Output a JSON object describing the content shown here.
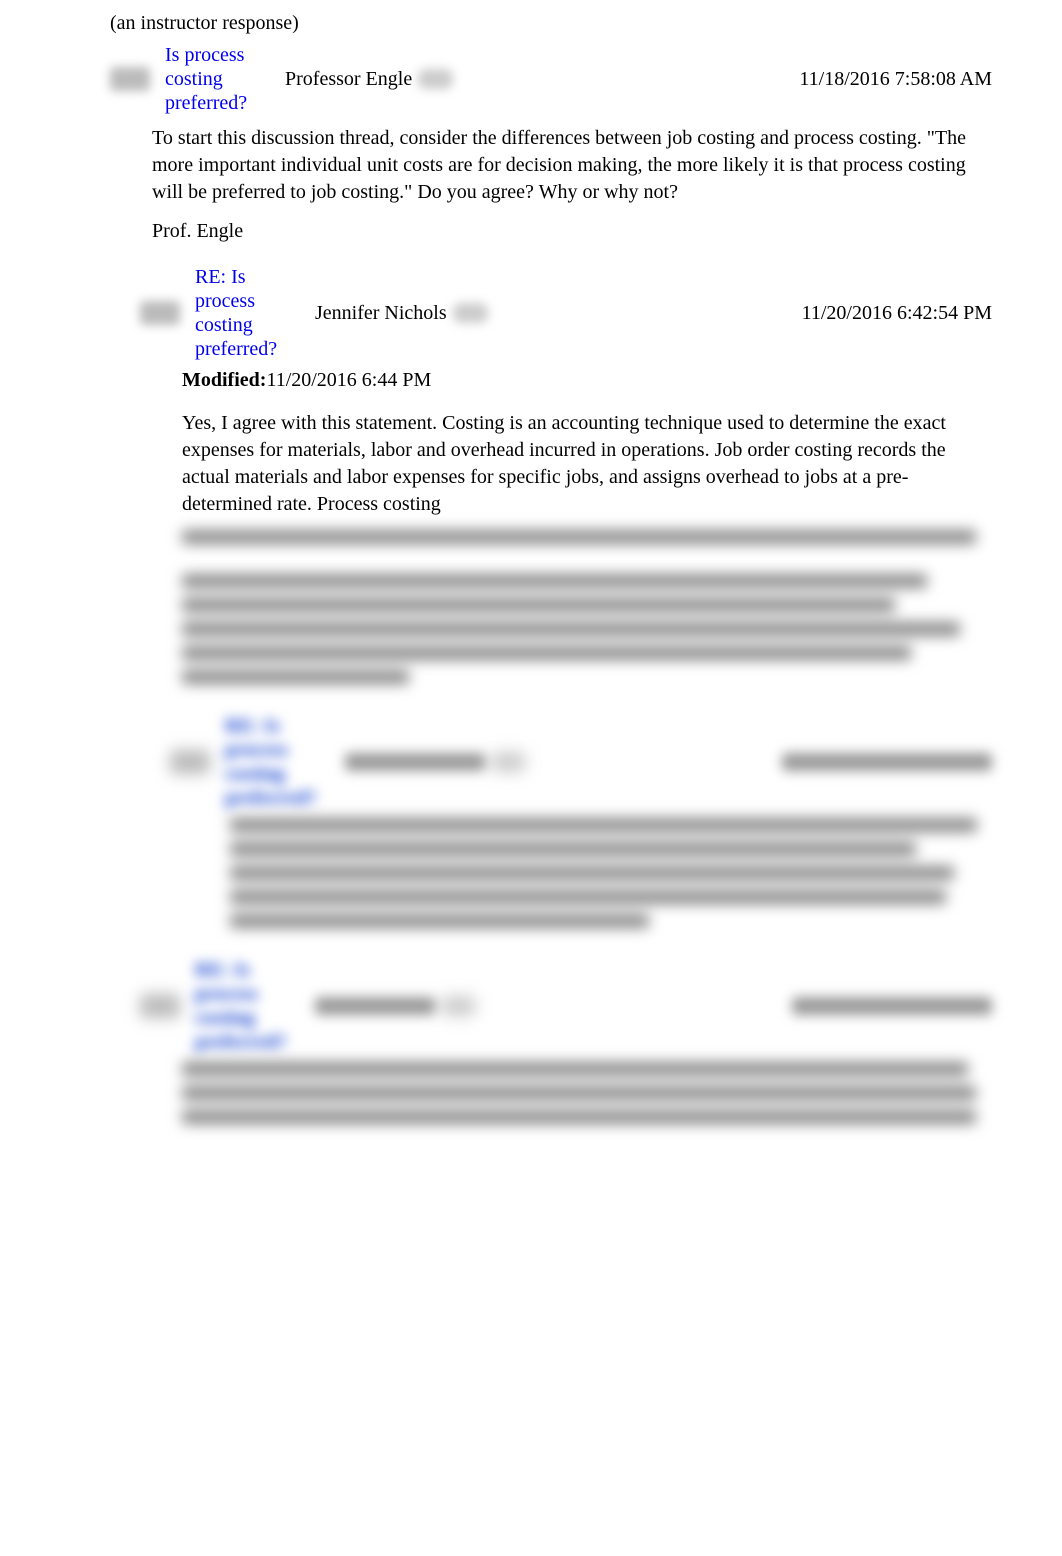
{
  "instructor_note": "(an instructor response)",
  "thread": {
    "subject": "Is process costing preferred?",
    "author": "Professor Engle",
    "timestamp": "11/18/2016 7:58:08 AM",
    "body_p1": "To start this discussion thread, consider the differences between job costing and process costing. \"The more important individual unit costs are for decision making, the more likely it is that process costing will be preferred to job costing.\" Do you agree? Why or why not?",
    "body_p2": "Prof. Engle"
  },
  "reply1": {
    "subject": "RE: Is process costing preferred?",
    "author": "Jennifer Nichols",
    "timestamp": "11/20/2016 6:42:54 PM",
    "modified_label": "Modified:",
    "modified_time": "11/20/2016 6:44 PM",
    "body_p1": "Yes, I agree with this statement. Costing is an accounting technique used to determine the exact expenses for materials, labor and overhead incurred in operations. Job order costing records the actual materials and labor expenses for specific jobs, and assigns overhead to jobs at a pre-determined rate. Process costing"
  },
  "reply2": {
    "subject": "RE: Is process costing preferred?"
  },
  "reply3": {
    "subject": "RE: Is process costing preferred?"
  }
}
